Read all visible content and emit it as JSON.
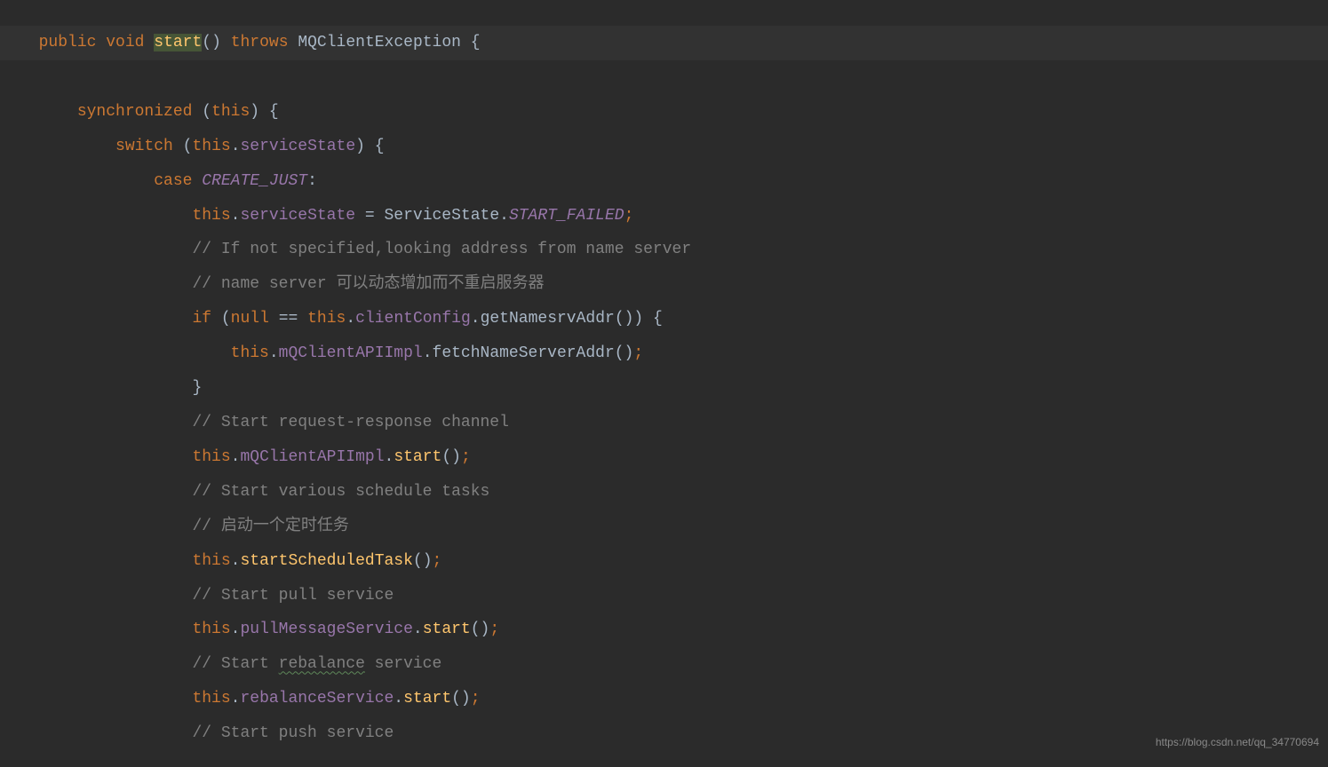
{
  "code": {
    "l1": {
      "public": "public",
      "void": "void",
      "start": "start",
      "parens": "()",
      "throws": "throws",
      "exc": "MQClientException",
      "brace": "{"
    },
    "l2": {
      "sync": "synchronized",
      "this": "this",
      "brace": "{"
    },
    "l3": {
      "switch": "switch",
      "this": "this",
      "dot": ".",
      "field": "serviceState",
      "brace": "{"
    },
    "l4": {
      "case": "case",
      "const": "CREATE_JUST",
      "colon": ":"
    },
    "l5": {
      "this": "this",
      "dot": ".",
      "field": "serviceState",
      "eq": " = ",
      "cls": "ServiceState",
      "dot2": ".",
      "const": "START_FAILED",
      "semi": ";"
    },
    "l6": "// If not specified,looking address from name server",
    "l7": "// name server 可以动态增加而不重启服务器",
    "l8": {
      "if": "if",
      "null": "null",
      "eq": " == ",
      "this": "this",
      "dot": ".",
      "field": "clientConfig",
      "dot2": ".",
      "method": "getNamesrvAddr",
      "parens": "()",
      "cparen": ") ",
      "brace": "{"
    },
    "l9": {
      "this": "this",
      "dot": ".",
      "field": "mQClientAPIImpl",
      "dot2": ".",
      "method": "fetchNameServerAddr",
      "parens": "()",
      "semi": ";"
    },
    "l10": "}",
    "l11": "// Start request-response channel",
    "l12": {
      "this": "this",
      "dot": ".",
      "field": "mQClientAPIImpl",
      "dot2": ".",
      "method": "start",
      "parens": "()",
      "semi": ";"
    },
    "l13": "// Start various schedule tasks",
    "l14": "// 启动一个定时任务",
    "l15": {
      "this": "this",
      "dot": ".",
      "method": "startScheduledTask",
      "parens": "()",
      "semi": ";"
    },
    "l16": "// Start pull service",
    "l17": {
      "this": "this",
      "dot": ".",
      "field": "pullMessageService",
      "dot2": ".",
      "method": "start",
      "parens": "()",
      "semi": ";"
    },
    "l18_a": "// Start ",
    "l18_b": "rebalance",
    "l18_c": " service",
    "l19": {
      "this": "this",
      "dot": ".",
      "field": "rebalanceService",
      "dot2": ".",
      "method": "start",
      "parens": "()",
      "semi": ";"
    },
    "l20": "// Start push service"
  },
  "indent": {
    "i1": "  ",
    "i2": "      ",
    "i3": "          ",
    "i4": "              ",
    "i5": "                  ",
    "i6": "                      "
  },
  "watermark": "https://blog.csdn.net/qq_34770694"
}
